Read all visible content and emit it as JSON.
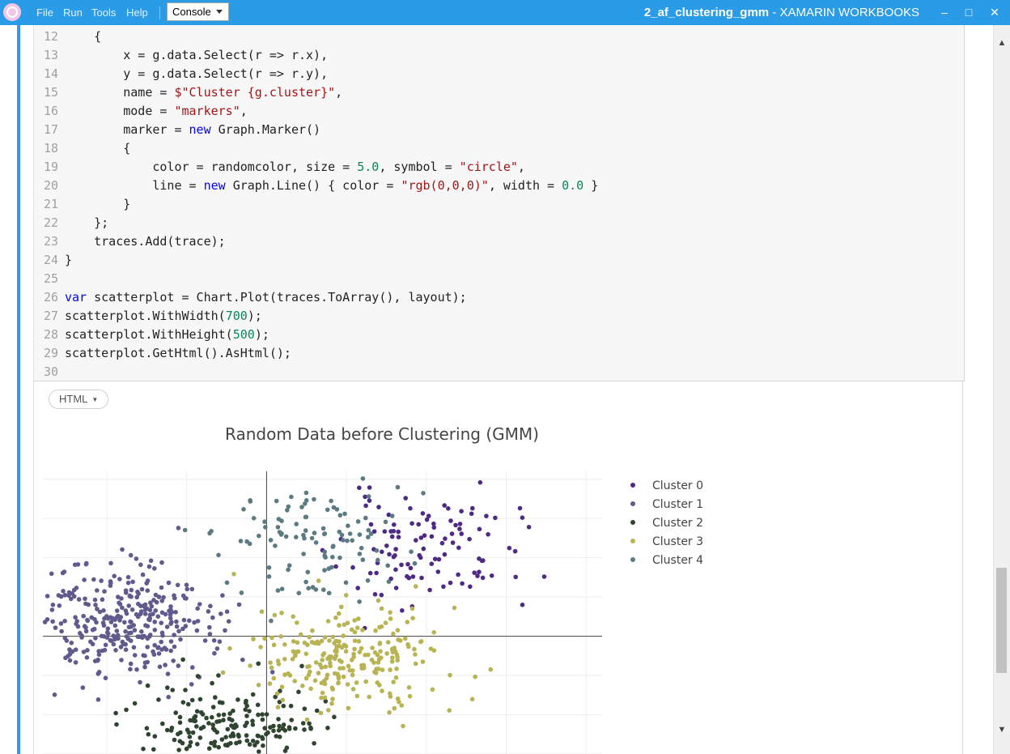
{
  "menu": {
    "file": "File",
    "run": "Run",
    "tools": "Tools",
    "help": "Help"
  },
  "console_select": "Console",
  "window": {
    "doc": "2_af_clustering_gmm",
    "app": " - XAMARIN WORKBOOKS"
  },
  "window_buttons": {
    "minimize": "–",
    "maximize": "□",
    "close": "✕"
  },
  "code_lines": [
    {
      "n": "12",
      "text": "    {"
    },
    {
      "n": "13",
      "text": "        x = g.data.Select(r => r.x),"
    },
    {
      "n": "14",
      "text": "        y = g.data.Select(r => r.y),"
    },
    {
      "n": "15",
      "text": "        name = $\"Cluster {g.cluster}\","
    },
    {
      "n": "16",
      "text": "        mode = \"markers\","
    },
    {
      "n": "17",
      "text": "        marker = new Graph.Marker()"
    },
    {
      "n": "18",
      "text": "        {"
    },
    {
      "n": "19",
      "text": "            color = randomcolor, size = 5.0, symbol = \"circle\","
    },
    {
      "n": "20",
      "text": "            line = new Graph.Line() { color = \"rgb(0,0,0)\", width = 0.0 }"
    },
    {
      "n": "21",
      "text": "        }"
    },
    {
      "n": "22",
      "text": "    };"
    },
    {
      "n": "23",
      "text": "    traces.Add(trace);"
    },
    {
      "n": "24",
      "text": "}"
    },
    {
      "n": "25",
      "text": ""
    },
    {
      "n": "26",
      "text": "var scatterplot = Chart.Plot(traces.ToArray(), layout);"
    },
    {
      "n": "27",
      "text": "scatterplot.WithWidth(700);"
    },
    {
      "n": "28",
      "text": "scatterplot.WithHeight(500);"
    },
    {
      "n": "29",
      "text": "scatterplot.GetHtml().AsHtml();"
    },
    {
      "n": "30",
      "text": ""
    }
  ],
  "output_format": "HTML",
  "output_format_caret": "▼",
  "scroll": {
    "up": "▲",
    "down": "▼"
  },
  "chart_data": {
    "type": "scatter",
    "title": "Random Data before Clustering (GMM)",
    "xlim": [
      -2.8,
      4.2
    ],
    "ylim": [
      -3.0,
      4.2
    ],
    "grid": true,
    "legend_position": "right",
    "series": [
      {
        "name": "Cluster 0",
        "color": "#4e2a84",
        "center": [
          2.0,
          2.2
        ],
        "spread": [
          0.55,
          0.7
        ],
        "count": 110,
        "seed": 11
      },
      {
        "name": "Cluster 1",
        "color": "#5f5b8c",
        "center": [
          -1.8,
          0.3
        ],
        "spread": [
          0.55,
          0.75
        ],
        "count": 330,
        "seed": 23
      },
      {
        "name": "Cluster 2",
        "color": "#2f4530",
        "center": [
          -0.4,
          -2.3
        ],
        "spread": [
          0.55,
          0.55
        ],
        "count": 190,
        "seed": 37
      },
      {
        "name": "Cluster 3",
        "color": "#b8b454",
        "center": [
          1.0,
          -0.5
        ],
        "spread": [
          0.55,
          0.75
        ],
        "count": 240,
        "seed": 41
      },
      {
        "name": "Cluster 4",
        "color": "#5b7a82",
        "center": [
          0.6,
          2.4
        ],
        "spread": [
          0.6,
          0.7
        ],
        "count": 110,
        "seed": 53
      }
    ]
  }
}
